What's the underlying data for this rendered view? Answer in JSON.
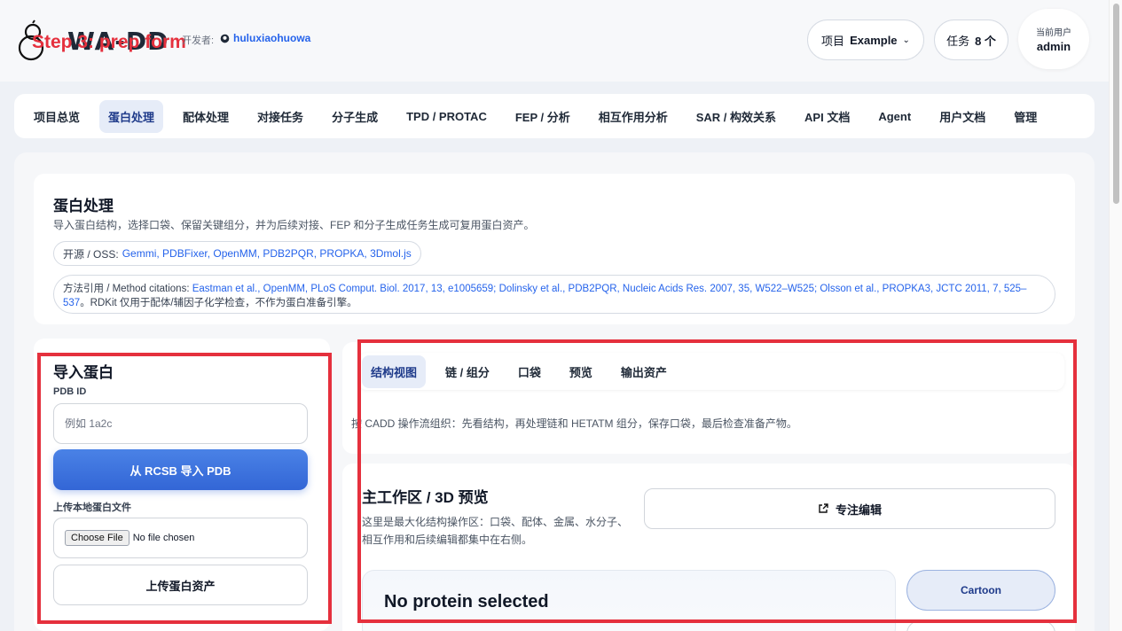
{
  "header": {
    "logo_text": "WA-DD",
    "step_label": "Step 3: prep form",
    "developer_label": "开发者:",
    "developer_name": "huluxiaohuowa",
    "project_label": "项目",
    "project_value": "Example",
    "task_label": "任务",
    "task_count": "8 个",
    "user_caption": "当前用户",
    "user_name": "admin"
  },
  "nav": {
    "items": [
      "项目总览",
      "蛋白处理",
      "配体处理",
      "对接任务",
      "分子生成",
      "TPD / PROTAC",
      "FEP / 分析",
      "相互作用分析",
      "SAR / 构效关系",
      "API 文档",
      "Agent",
      "用户文档",
      "管理"
    ],
    "active_index": 1
  },
  "intro": {
    "title": "蛋白处理",
    "description": "导入蛋白结构，选择口袋、保留关键组分，并为后续对接、FEP 和分子生成任务生成可复用蛋白资产。",
    "oss_prefix": "开源 / OSS:",
    "oss_tools": "Gemmi, PDBFixer, OpenMM, PDB2PQR, PROPKA, 3Dmol.js",
    "citations_prefix": "方法引用 / Method citations:",
    "citations_links": "Eastman et al., OpenMM, PLoS Comput. Biol. 2017, 13, e1005659; Dolinsky et al., PDB2PQR, Nucleic Acids Res. 2007, 35, W522–W525; Olsson et al., PROPKA3, JCTC 2011, 7, 525–537",
    "citations_suffix": "。RDKit 仅用于配体/辅因子化学检查，不作为蛋白准备引擎。"
  },
  "import": {
    "title": "导入蛋白",
    "pdb_label": "PDB ID",
    "pdb_placeholder": "例如 1a2c",
    "import_button": "从 RCSB 导入 PDB",
    "upload_label": "上传本地蛋白文件",
    "choose_file": "Choose File",
    "no_file": "No file chosen",
    "upload_button": "上传蛋白资产"
  },
  "workspace": {
    "tabs": [
      "结构视图",
      "链 / 组分",
      "口袋",
      "预览",
      "输出资产"
    ],
    "active_tab": 0,
    "flow_note": "按 CADD 操作流组织：先看结构，再处理链和 HETATM 组分，保存口袋，最后检查准备产物。",
    "title": "主工作区 / 3D 预览",
    "description": "这里是最大化结构操作区：口袋、配体、金属、水分子、相互作用和后续编辑都集中在右侧。",
    "focus_button": "专注编辑",
    "viewer_message": "No protein selected",
    "style_button": "Cartoon"
  },
  "colors": {
    "accent": "#3366d6",
    "highlight": "#e5303d",
    "link": "#2563eb"
  }
}
